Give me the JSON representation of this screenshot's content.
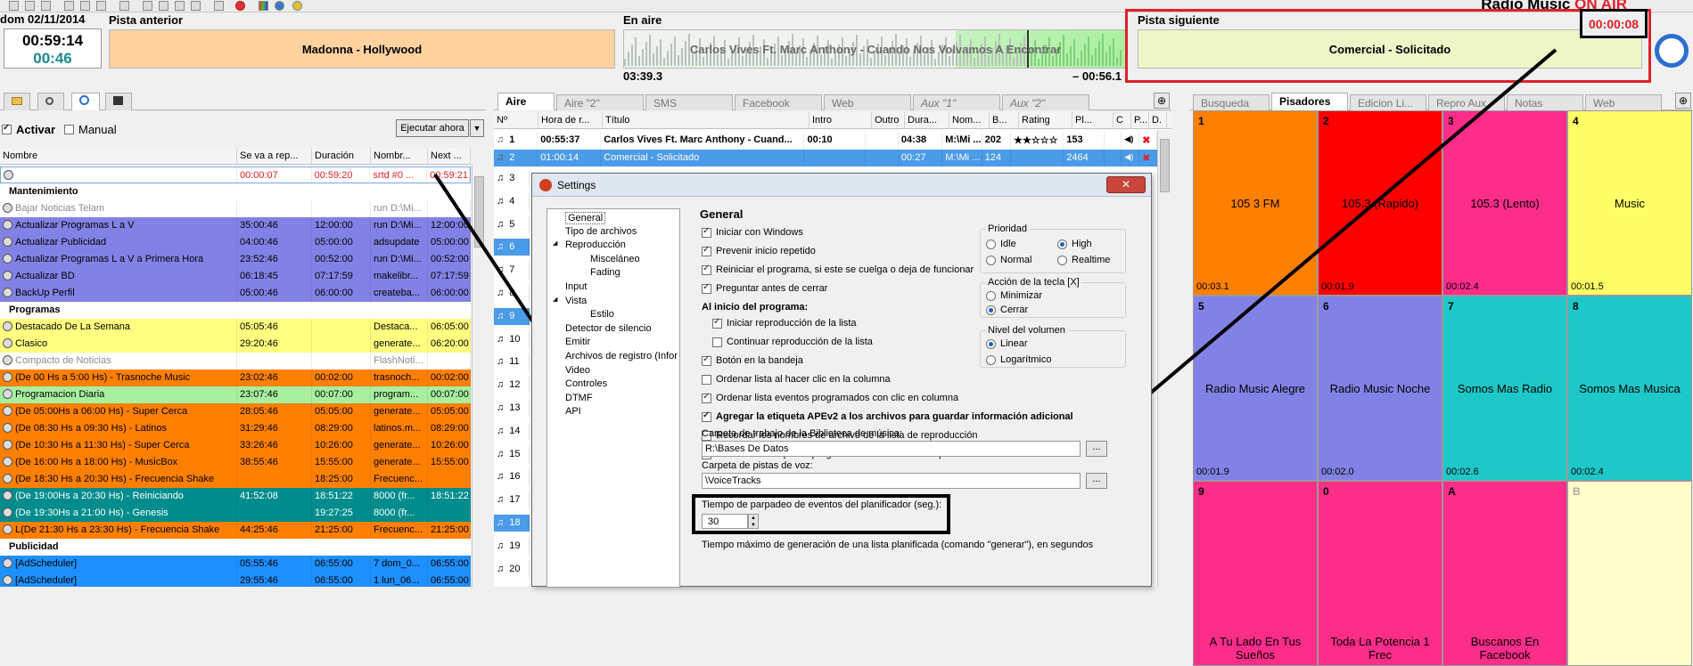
{
  "header": {
    "date": "dom 02/11/2014",
    "clock": "00:59:14",
    "remaining": "00:46",
    "prev_label": "Pista anterior",
    "prev_track": "Madonna - Hollywood",
    "onair_label": "En aire",
    "onair_track": "Carlos Vives Ft. Marc Anthony - Cuando Nos Volvamos A Encontrar",
    "elapsed": "03:39.3",
    "remain_track": "– 00:56.1",
    "next_label": "Pista siguiente",
    "next_track": "Comercial - Solicitado",
    "countdown": "00:00:08",
    "station": "Radio Music",
    "status": "ON AIR"
  },
  "left": {
    "activar": "Activar",
    "manual": "Manual",
    "exec_btn": "Ejecutar ahora",
    "cols": [
      "Nombre",
      "Se va a rep...",
      "Duración",
      "Nombr...",
      "Next ..."
    ],
    "rows": [
      {
        "t": "r",
        "name": "",
        "c1": "00:00:07",
        "c2": "00:59:20",
        "c3": "srtd #0 ...",
        "c4": "00:59:21",
        "bg": "#ffffff",
        "fg": "#e0202a"
      },
      {
        "t": "g",
        "name": "Mantenimiento"
      },
      {
        "t": "r",
        "name": "Bajar Noticias Telam",
        "c1": "",
        "c2": "",
        "c3": "run D:\\Mi...",
        "c4": "",
        "bg": "#ffffff",
        "fg": "#8c8c8c"
      },
      {
        "t": "r",
        "name": "Actualizar Programas L a V",
        "c1": "35:00:46",
        "c2": "12:00:00",
        "c3": "run D:\\Mi...",
        "c4": "12:00:00",
        "bg": "#8282e6",
        "fg": "#000"
      },
      {
        "t": "r",
        "name": "Actualizar Publicidad",
        "c1": "04:00:46",
        "c2": "05:00:00",
        "c3": "adsupdate",
        "c4": "05:00:00",
        "bg": "#8282e6",
        "fg": "#000"
      },
      {
        "t": "r",
        "name": "Actualizar Programas L a V a Primera Hora",
        "c1": "23:52:46",
        "c2": "00:52:00",
        "c3": "run D:\\Mi...",
        "c4": "00:52:00",
        "bg": "#8282e6",
        "fg": "#000"
      },
      {
        "t": "r",
        "name": "Actualizar BD",
        "c1": "06:18:45",
        "c2": "07:17:59",
        "c3": "makelibr...",
        "c4": "07:17:59",
        "bg": "#8282e6",
        "fg": "#000"
      },
      {
        "t": "r",
        "name": "BackUp Perfil",
        "c1": "05:00:46",
        "c2": "06:00:00",
        "c3": "createba...",
        "c4": "06:00:00",
        "bg": "#8282e6",
        "fg": "#000"
      },
      {
        "t": "g",
        "name": "Programas"
      },
      {
        "t": "r",
        "name": "Destacado De La Semana",
        "c1": "05:05:46",
        "c2": "",
        "c3": "Destaca...",
        "c4": "06:05:00",
        "bg": "#ffff80",
        "fg": "#000"
      },
      {
        "t": "r",
        "name": "Clasico",
        "c1": "29:20:46",
        "c2": "",
        "c3": "generate...",
        "c4": "06:20:00",
        "bg": "#ffff80",
        "fg": "#000"
      },
      {
        "t": "r",
        "name": "Compacto de Noticias",
        "c1": "",
        "c2": "",
        "c3": "FlashNoti...",
        "c4": "",
        "bg": "#ffffff",
        "fg": "#8c8c8c"
      },
      {
        "t": "r",
        "name": "(De 00 Hs a 5:00 Hs) - Trasnoche Music",
        "c1": "23:02:46",
        "c2": "00:02:00",
        "c3": "trasnoch...",
        "c4": "00:02:00",
        "bg": "#ff8000",
        "fg": "#000"
      },
      {
        "t": "r",
        "name": "Programacion Diaria",
        "c1": "23:07:46",
        "c2": "00:07:00",
        "c3": "program...",
        "c4": "00:07:00",
        "bg": "#a8f0a0",
        "fg": "#000"
      },
      {
        "t": "r",
        "name": "(De 05:00Hs a 06:00 Hs) - Super Cerca",
        "c1": "28:05:46",
        "c2": "05:05:00",
        "c3": "generate...",
        "c4": "05:05:00",
        "bg": "#ff8000",
        "fg": "#000"
      },
      {
        "t": "r",
        "name": "(De 08:30 Hs a 09:30 Hs) - Latinos",
        "c1": "31:29:46",
        "c2": "08:29:00",
        "c3": "latinos.m...",
        "c4": "08:29:00",
        "bg": "#ff8000",
        "fg": "#000"
      },
      {
        "t": "r",
        "name": "(De 10:30 Hs a 11:30 Hs) - Super Cerca",
        "c1": "33:26:46",
        "c2": "10:26:00",
        "c3": "generate...",
        "c4": "10:26:00",
        "bg": "#ff8000",
        "fg": "#000"
      },
      {
        "t": "r",
        "name": "(De 16:00 Hs a 18:00 Hs) - MusicBox",
        "c1": "38:55:46",
        "c2": "15:55:00",
        "c3": "generate...",
        "c4": "15:55:00",
        "bg": "#ff8000",
        "fg": "#000"
      },
      {
        "t": "r",
        "name": "(De 18:30 Hs a 20:30 Hs) - Frecuencia Shake",
        "c1": "",
        "c2": "18:25:00",
        "c3": "Frecuenc...",
        "c4": "",
        "bg": "#ff8000",
        "fg": "#000"
      },
      {
        "t": "r",
        "name": "(De 19:00Hs a 20:30 Hs) - Reiniciando",
        "c1": "41:52:08",
        "c2": "18:51:22",
        "c3": "8000 (fr...",
        "c4": "18:51:22",
        "bg": "#008c8c",
        "fg": "#fff"
      },
      {
        "t": "r",
        "name": "(De 19:30Hs a 21:00 Hs) - Genesis",
        "c1": "",
        "c2": "19:27:25",
        "c3": "8000 (fr...",
        "c4": "",
        "bg": "#008c8c",
        "fg": "#fff"
      },
      {
        "t": "r",
        "name": "L(De 21:30 Hs a 23:30 Hs) - Frecuencia Shake",
        "c1": "44:25:46",
        "c2": "21:25:00",
        "c3": "Frecuenc...",
        "c4": "21:25:00",
        "bg": "#ff8000",
        "fg": "#000"
      },
      {
        "t": "g",
        "name": "Publicidad"
      },
      {
        "t": "r",
        "name": "[AdScheduler]",
        "c1": "05:55:46",
        "c2": "06:55:00",
        "c3": "7 dom_0...",
        "c4": "06:55:00",
        "bg": "#1e90ff",
        "fg": "#000"
      },
      {
        "t": "r",
        "name": "[AdScheduler]",
        "c1": "29:55:46",
        "c2": "06:55:00",
        "c3": "1 lun_06...",
        "c4": "06:55:00",
        "bg": "#1e90ff",
        "fg": "#000"
      }
    ]
  },
  "mid": {
    "tabs": [
      "Aire",
      "Aire \"2\"",
      "SMS",
      "Facebook",
      "Web",
      "Aux \"1\"",
      "Aux \"2\""
    ],
    "cols": [
      "Nº",
      "Hora de r...",
      "Título",
      "Intro",
      "Outro",
      "Dura...",
      "Nom...",
      "B...",
      "Rating",
      "Pl...",
      "C",
      "P...",
      "D."
    ],
    "row1": {
      "n": "1",
      "hora": "00:55:37",
      "titulo": "Carlos Vives Ft. Marc Anthony - Cuand...",
      "intro": "00:10",
      "outro": "",
      "dur": "04:38",
      "nom": "M:\\Mi ...",
      "b": "202",
      "rating": "★★☆☆☆",
      "pl": "153"
    },
    "row2": {
      "n": "2",
      "hora": "01:00:14",
      "titulo": "Comercial - Solicitado",
      "intro": "",
      "outro": "",
      "dur": "00:27",
      "nom": "M:\\Mi ...",
      "b": "124",
      "rating": "",
      "pl": "2464"
    },
    "nums": [
      "3",
      "4",
      "5",
      "6",
      "7",
      "8",
      "9",
      "10",
      "11",
      "12",
      "13",
      "14",
      "15",
      "16",
      "17",
      "18",
      "19",
      "20"
    ]
  },
  "right": {
    "tabs": [
      "Busqueda",
      "Pisadores",
      "Edicion Li...",
      "Repro Aux",
      "Notas",
      "Web"
    ],
    "pads": [
      {
        "n": "1",
        "label": "105 3 FM",
        "time": "00:03.1",
        "bg": "#ff8000"
      },
      {
        "n": "2",
        "label": "105.3 (Rapido)",
        "time": "00:01.9",
        "bg": "#ff0000"
      },
      {
        "n": "3",
        "label": "105.3 (Lento)",
        "time": "00:02.4",
        "bg": "#ff2d8a"
      },
      {
        "n": "4",
        "label": "Music",
        "time": "00:01.5",
        "bg": "#ffff66"
      },
      {
        "n": "5",
        "label": "Radio Music Alegre",
        "time": "00:01.9",
        "bg": "#8282e6"
      },
      {
        "n": "6",
        "label": "Radio Music Noche",
        "time": "00:02.0",
        "bg": "#8282e6"
      },
      {
        "n": "7",
        "label": "Somos Mas Radio",
        "time": "00:02.6",
        "bg": "#1ec8c8"
      },
      {
        "n": "8",
        "label": "Somos Mas Musica",
        "time": "00:02.4",
        "bg": "#1ec8c8"
      },
      {
        "n": "9",
        "label": "A Tu Lado En Tus Sueños",
        "time": "",
        "bg": "#ff2d8a"
      },
      {
        "n": "0",
        "label": "Toda La Potencia 1 Frec",
        "time": "",
        "bg": "#ff2d8a"
      },
      {
        "n": "A",
        "label": "Buscanos En Facebook",
        "time": "",
        "bg": "#ff2d8a"
      },
      {
        "n": "B",
        "label": "",
        "time": "",
        "bg": "#ffffcc"
      }
    ]
  },
  "dialog": {
    "title": "Settings",
    "heading": "General",
    "tree": [
      "General",
      "Tipo de archivos",
      "Reproducción",
      "Misceláneo",
      "Fading",
      "Input",
      "Vista",
      "Estilo",
      "Detector de silencio",
      "Emitir",
      "Archivos de registro (Infor",
      "Video",
      "Controles",
      "DTMF",
      "API"
    ],
    "checks": [
      {
        "label": "Iniciar con Windows",
        "on": true
      },
      {
        "label": "Prevenir inicio repetido",
        "on": true
      },
      {
        "label": "Reiniciar el programa, si este se cuelga o deja de funcionar",
        "on": true
      },
      {
        "label": "Preguntar antes de cerrar",
        "on": true
      }
    ],
    "start_label": "Al inicio del programa:",
    "start_checks": [
      {
        "label": "Iniciar reproducción de la lista",
        "on": true
      },
      {
        "label": "Continuar reproducción de la lista",
        "on": false
      }
    ],
    "checks2": [
      {
        "label": "Botón en la bandeja",
        "on": true
      },
      {
        "label": "Ordenar lista al hacer clic en la columna",
        "on": false
      },
      {
        "label": "Ordenar lista eventos programados con clic en columna",
        "on": true
      },
      {
        "label": "Agregar la etiqueta APEv2 a los archivos para guardar información adicional",
        "on": true
      },
      {
        "label": "Recordar los nombres de archivo de la lista de reproducción",
        "on": false
      },
      {
        "label": "No eliminar las pistas programadas de la lista de reproducción al salir",
        "on": true
      }
    ],
    "music_folder_label": "Carpeta de trabajo de la Biblioteca de música:",
    "music_folder": "R:\\Bases De Datos",
    "voice_folder_label": "Carpeta de pistas de voz:",
    "voice_folder": "\\VoiceTracks",
    "blink_label": "Tiempo de parpadeo de eventos del planificador (seg.):",
    "blink_value": "30",
    "max_gen_label": "Tiempo máximo de generación de una lista planificada (comando \"generar\"), en segundos",
    "browse": "...",
    "prio_label": "Prioridad",
    "prio": [
      {
        "label": "Idle",
        "on": false
      },
      {
        "label": "High",
        "on": true
      },
      {
        "label": "Normal",
        "on": false
      },
      {
        "label": "Realtime",
        "on": false
      }
    ],
    "key_label": "Acción de la tecla [X]",
    "key": [
      {
        "label": "Minimizar",
        "on": false
      },
      {
        "label": "Cerrar",
        "on": true
      }
    ],
    "vol_label": "Nivel del volumen",
    "vol": [
      {
        "label": "Linear",
        "on": true
      },
      {
        "label": "Logarítmico",
        "on": false
      }
    ],
    "close": "✕"
  },
  "colors": {
    "accent_red": "#e0202a",
    "onair_blue": "#1e90ff",
    "highlight": "#4a9be8"
  }
}
